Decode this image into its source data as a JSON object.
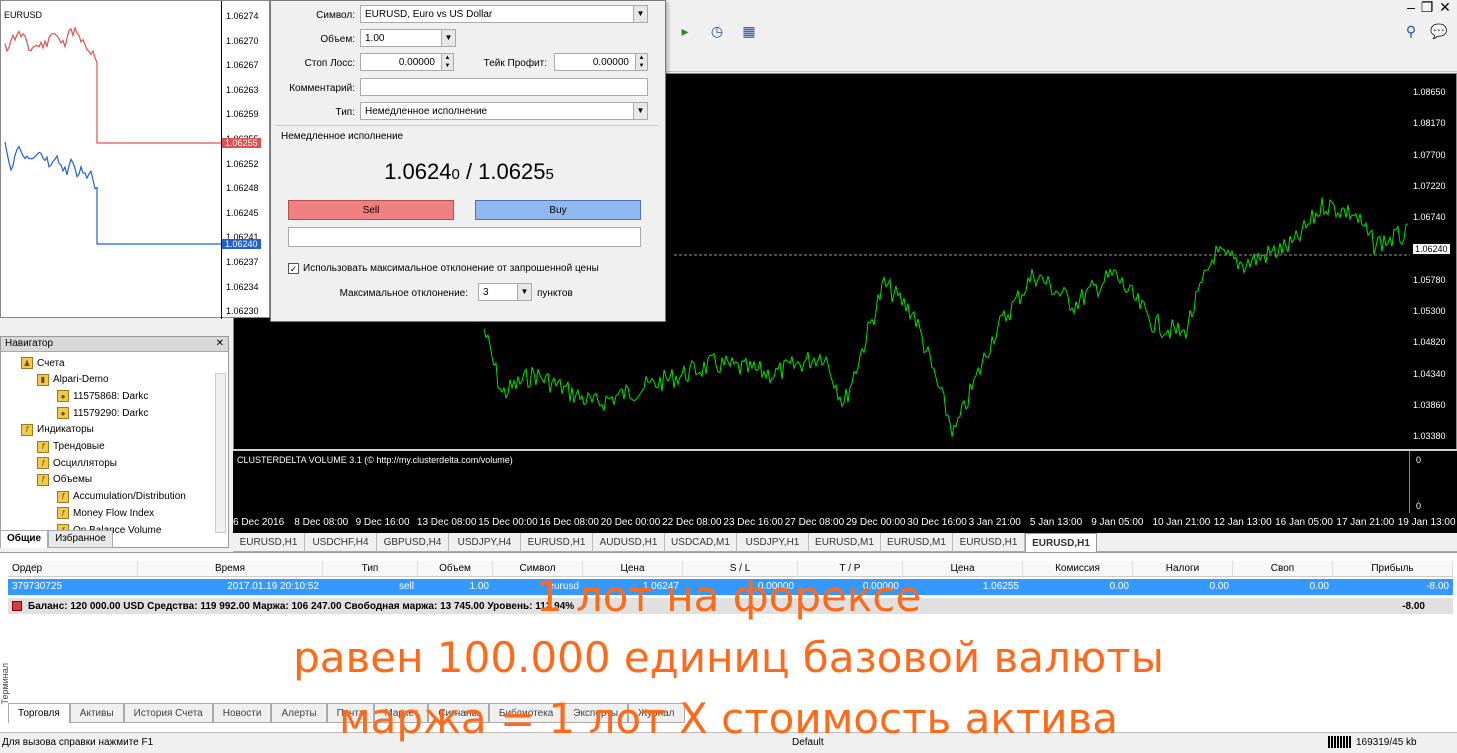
{
  "mini_chart": {
    "symbol": "EURUSD",
    "prices": [
      "1.06274",
      "1.06270",
      "1.06267",
      "1.06263",
      "1.06259",
      "1.06255",
      "1.06252",
      "1.06248",
      "1.06245",
      "1.06241",
      "1.06237",
      "1.06234",
      "1.06230"
    ],
    "ask_label": "1.06255",
    "bid_label": "1.06240",
    "colors": {
      "ask": "#e05050",
      "bid": "#2060d0"
    }
  },
  "order_dialog": {
    "symbol_label": "Символ:",
    "symbol_value": "EURUSD, Euro vs US Dollar",
    "volume_label": "Объем:",
    "volume_value": "1.00",
    "sl_label": "Стоп Лосс:",
    "sl_value": "0.00000",
    "tp_label": "Тейк Профит:",
    "tp_value": "0.00000",
    "comment_label": "Комментарий:",
    "comment_value": "",
    "type_label": "Тип:",
    "type_value": "Немедленное исполнение",
    "section_title": "Немедленное исполнение",
    "bid_main": "1.0624",
    "bid_small": "0",
    "separator": " / ",
    "ask_main": "1.0625",
    "ask_small": "5",
    "sell_label": "Sell",
    "buy_label": "Buy",
    "max_dev_checkbox_label": "Использовать максимальное отклонение от запрошенной цены",
    "max_dev_checked": true,
    "max_dev_label": "Максимальное отклонение:",
    "max_dev_value": "3",
    "max_dev_unit": "пунктов"
  },
  "main_chart": {
    "price_labels": [
      "1.08650",
      "1.08170",
      "1.07700",
      "1.07220",
      "1.06740",
      "1.06240",
      "1.05780",
      "1.05300",
      "1.04820",
      "1.04340",
      "1.03860",
      "1.03380"
    ],
    "current_price": "1.06240",
    "indicator_title": "CLUSTERDELTA VOLUME 3.1 (© http://my.clusterdelta.com/volume)",
    "indicator_axis": [
      "0",
      "0"
    ],
    "date_labels": [
      "6 Dec 2016",
      "8 Dec 08:00",
      "9 Dec 16:00",
      "13 Dec 08:00",
      "15 Dec 00:00",
      "16 Dec 08:00",
      "20 Dec 00:00",
      "22 Dec 08:00",
      "23 Dec 16:00",
      "27 Dec 08:00",
      "29 Dec 00:00",
      "30 Dec 16:00",
      "3 Jan 21:00",
      "5 Jan 13:00",
      "9 Jan 05:00",
      "10 Jan 21:00",
      "12 Jan 13:00",
      "16 Jan 05:00",
      "17 Jan 21:00",
      "19 Jan 13:00"
    ],
    "line_color": "#00e000"
  },
  "chart_tabs": [
    "EURUSD,H1",
    "USDCHF,H4",
    "GBPUSD,H4",
    "USDJPY,H4",
    "EURUSD,H1",
    "AUDUSD,H1",
    "USDCAD,M1",
    "USDJPY,H1",
    "EURUSD,M1",
    "EURUSD,M1",
    "EURUSD,H1",
    "EURUSD,H1"
  ],
  "navigator": {
    "title": "Навигатор",
    "items": [
      {
        "label": "Счета",
        "icon": "accounts-icon"
      },
      {
        "label": "Alpari-Demo",
        "icon": "server-icon"
      },
      {
        "label": "11575868: Darkc",
        "icon": "user-icon"
      },
      {
        "label": "11579290: Darkc",
        "icon": "user-icon"
      },
      {
        "label": "Индикаторы",
        "icon": "indicator-icon"
      },
      {
        "label": "Трендовые",
        "icon": "indicator-icon"
      },
      {
        "label": "Осцилляторы",
        "icon": "indicator-icon"
      },
      {
        "label": "Объемы",
        "icon": "indicator-icon"
      },
      {
        "label": "Accumulation/Distribution",
        "icon": "indicator-icon"
      },
      {
        "label": "Money Flow Index",
        "icon": "indicator-icon"
      },
      {
        "label": "On Balance Volume",
        "icon": "indicator-icon"
      }
    ],
    "tabs": [
      "Общие",
      "Избранное"
    ]
  },
  "terminal": {
    "headers": [
      "Ордер",
      "Время",
      "Тип",
      "Объем",
      "Символ",
      "Цена",
      "S / L",
      "T / P",
      "Цена",
      "Комиссия",
      "Налоги",
      "Своп",
      "Прибыль"
    ],
    "row": [
      "379730725",
      "2017.01.19 20:10:52",
      "sell",
      "1.00",
      "eurusd",
      "1.06247",
      "0.00000",
      "0.00000",
      "1.06255",
      "0.00",
      "0.00",
      "0.00",
      "-8.00"
    ],
    "balance_text": "Баланс: 120 000.00 USD  Средства: 119 992.00  Маржа: 106 247.00  Свободная маржа: 13 745.00  Уровень: 112.94%",
    "balance_profit": "-8.00",
    "tabs": [
      "Торговля",
      "Активы",
      "История Счета",
      "Новости",
      "Алерты",
      "Почта",
      "Маркет",
      "Сигналы",
      "Библиотека",
      "Эксперты",
      "Журнал"
    ],
    "side_label": "Терминал"
  },
  "status": {
    "help": "Для вызова справки нажмите F1",
    "profile": "Default",
    "traffic": "169319/45 kb"
  },
  "overlay": {
    "line1": "1 лот на форексе",
    "line2": "равен 100.000 единиц базовой валюты",
    "line3": "маржа = 1 лот X стоимость актива",
    "color": "#ff6a1a"
  }
}
